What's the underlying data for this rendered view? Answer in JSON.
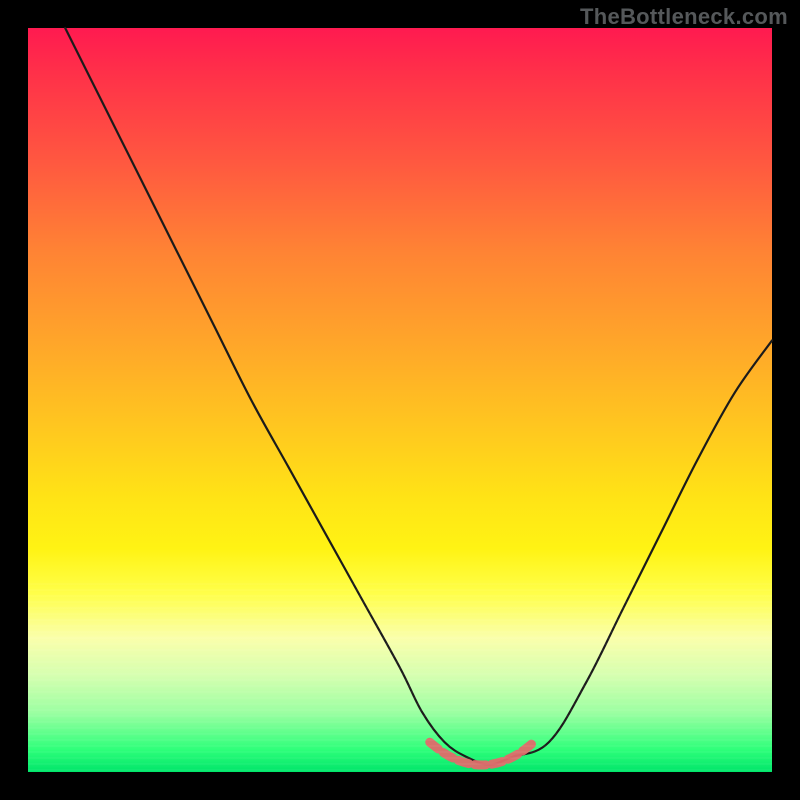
{
  "watermark": "TheBottleneck.com",
  "chart_data": {
    "type": "line",
    "title": "",
    "xlabel": "",
    "ylabel": "",
    "xlim": [
      0,
      100
    ],
    "ylim": [
      0,
      100
    ],
    "grid": false,
    "legend": false,
    "series": [
      {
        "name": "bottleneck-curve",
        "x": [
          5,
          10,
          15,
          20,
          25,
          30,
          35,
          40,
          45,
          50,
          53,
          56,
          59,
          62,
          65,
          70,
          75,
          80,
          85,
          90,
          95,
          100
        ],
        "y": [
          100,
          90,
          80,
          70,
          60,
          50,
          41,
          32,
          23,
          14,
          8,
          4,
          2,
          1,
          2,
          4,
          12,
          22,
          32,
          42,
          51,
          58
        ]
      },
      {
        "name": "optimal-zone",
        "x": [
          54,
          56,
          58,
          60,
          62,
          64,
          66,
          68
        ],
        "y": [
          4,
          2.5,
          1.5,
          1,
          1,
          1.5,
          2.5,
          4
        ]
      }
    ],
    "background_gradient_stops": [
      {
        "pos": 0.0,
        "color": "#ff1a50"
      },
      {
        "pos": 0.5,
        "color": "#ffc81f"
      },
      {
        "pos": 0.78,
        "color": "#ffff4a"
      },
      {
        "pos": 1.0,
        "color": "#00e56a"
      }
    ]
  }
}
